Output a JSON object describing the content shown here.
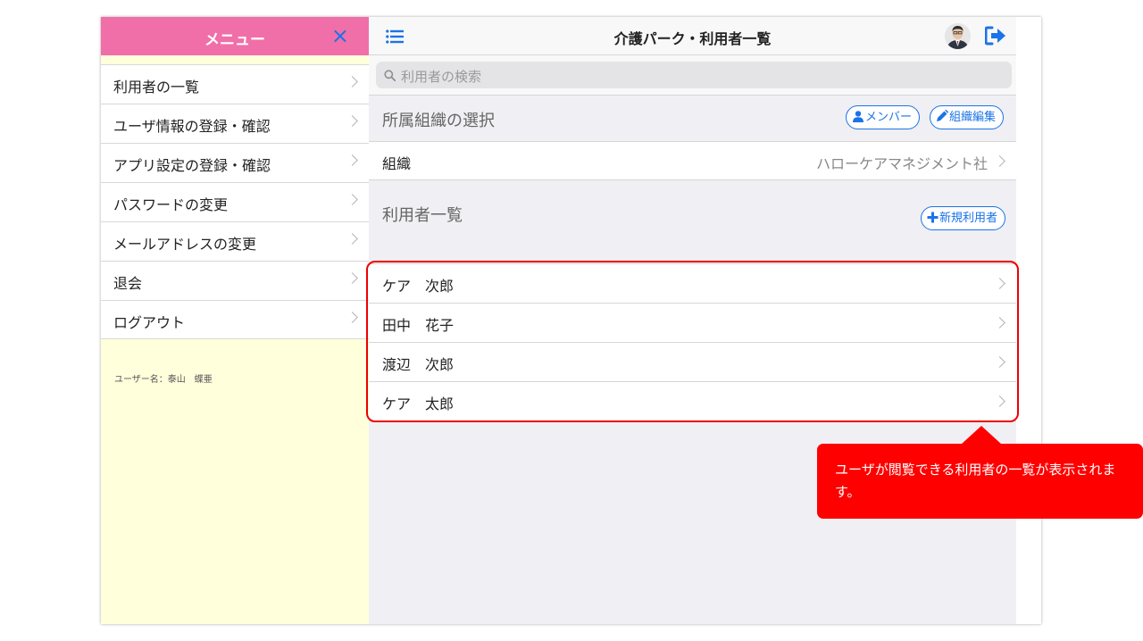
{
  "sidebar": {
    "title": "メニュー",
    "close_icon": "×",
    "items": [
      {
        "label": "利用者の一覧"
      },
      {
        "label": "ユーザ情報の登録・確認"
      },
      {
        "label": "アプリ設定の登録・確認"
      },
      {
        "label": "パスワードの変更"
      },
      {
        "label": "メールアドレスの変更"
      },
      {
        "label": "退会"
      },
      {
        "label": "ログアウト"
      }
    ],
    "username": "ユーザー名：泰山　蝶亜"
  },
  "header": {
    "title": "介護パーク・利用者一覧"
  },
  "search": {
    "placeholder": "利用者の検索"
  },
  "org_section": {
    "title": "所属組織の選択",
    "member_button": "メンバー",
    "edit_button": "組織編集",
    "org_label": "組織",
    "org_value": "ハローケアマネジメント社"
  },
  "user_section": {
    "title": "利用者一覧",
    "new_button": "新規利用者",
    "users": [
      {
        "name": "ケア　次郎"
      },
      {
        "name": "田中　花子"
      },
      {
        "name": "渡辺　次郎"
      },
      {
        "name": "ケア　太郎"
      }
    ]
  },
  "annotation": {
    "text": "ユーザが閲覧できる利用者の一覧が表示されます。"
  },
  "colors": {
    "menu_header": "#f06fa8",
    "sidebar_bg": "#ffffdc",
    "accent": "#1a73e8",
    "callout": "#ff0000"
  }
}
